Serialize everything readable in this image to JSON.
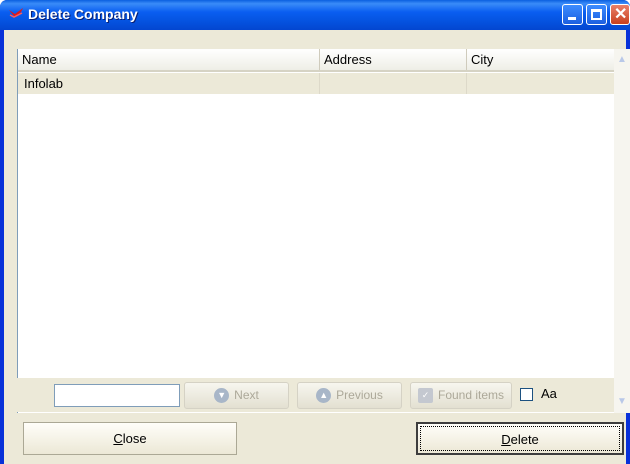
{
  "window": {
    "title": "Delete Company",
    "icon": "red-app-icon"
  },
  "title_buttons": {
    "minimize_icon": "minimize-icon",
    "maximize_icon": "maximize-icon",
    "close_icon": "close-icon",
    "close_glyph": "✕"
  },
  "table": {
    "columns": [
      "Name",
      "Address",
      "City"
    ],
    "rows": [
      {
        "name": "Infolab",
        "address": "",
        "city": ""
      }
    ]
  },
  "search": {
    "value": "",
    "next_label": "Next",
    "previous_label": "Previous",
    "found_items_label": "Found items",
    "case_sensitive_label": "Aa",
    "case_sensitive_checked": false
  },
  "buttons": {
    "close_first": "C",
    "close_rest": "lose",
    "delete_first": "D",
    "delete_rest": "elete"
  },
  "colors": {
    "titlebar": "#0a5ef1",
    "frame": "#0831d9",
    "face": "#ece9d8",
    "close_button": "#c8401e"
  }
}
